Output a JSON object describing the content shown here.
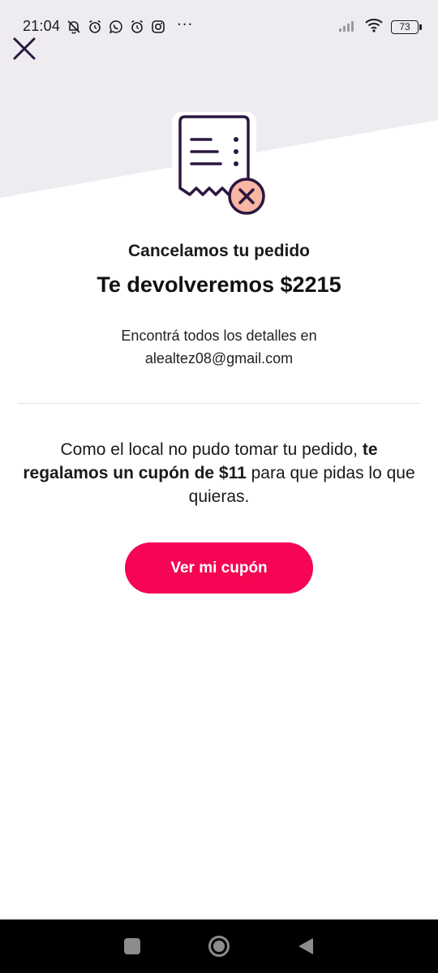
{
  "status_bar": {
    "time": "21:04",
    "battery": "73",
    "icons": [
      "muted-bell-icon",
      "alarm-icon",
      "whatsapp-icon",
      "alarm-icon",
      "instagram-icon"
    ],
    "overflow": "···"
  },
  "header": {
    "close_icon": "close-icon"
  },
  "illustration": {
    "icon": "receipt-cancel-icon",
    "badge_color": "#f8b6a4"
  },
  "content": {
    "title": "Cancelamos tu pedido",
    "amount_text": "Te devolveremos $2215",
    "details_line1": "Encontrá todos los detalles en",
    "details_email": "alealtez08@gmail.com",
    "coupon_prefix": "Como el local no pudo tomar tu pedido, ",
    "coupon_bold": "te regalamos un cupón de $11",
    "coupon_suffix": " para que pidas lo que quieras."
  },
  "cta": {
    "label": "Ver mi cupón"
  },
  "colors": {
    "accent": "#f50553",
    "wedge": "#eeecf1",
    "dark_purple": "#2b1740"
  },
  "nav_bar": {
    "buttons": [
      "recents-icon",
      "home-icon",
      "back-icon"
    ]
  }
}
